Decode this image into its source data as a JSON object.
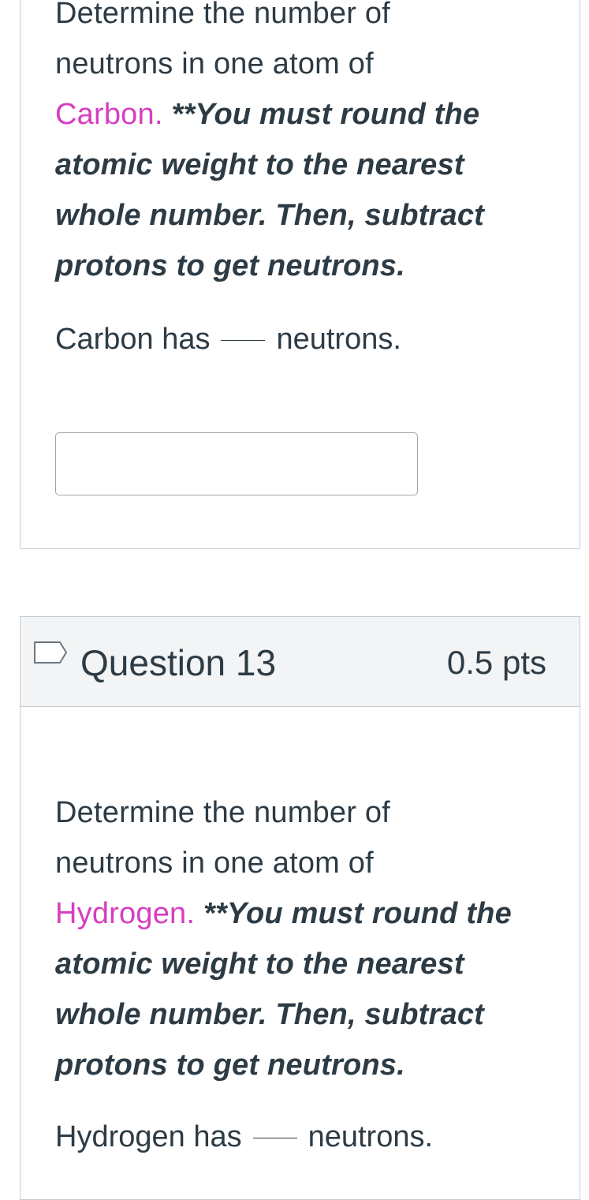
{
  "question_12": {
    "line1": "Determine the number of",
    "line2": "neutrons in one atom of",
    "element": "Carbon.",
    "emph1": " **You must round the",
    "emph2": "atomic weight to the nearest",
    "emph3": "whole number. Then, subtract",
    "emph4": "protons to get neutrons.",
    "fill_before": "Carbon has",
    "fill_after": "neutrons.",
    "answer_value": ""
  },
  "question_13": {
    "title": "Question 13",
    "points": "0.5 pts",
    "line1": "Determine the number of",
    "line2": "neutrons in one atom of",
    "element": "Hydrogen.",
    "emph1": " **You must round the",
    "emph2": "atomic weight to the nearest",
    "emph3": "whole number. Then, subtract",
    "emph4": "protons to get neutrons.",
    "fill_before": "Hydrogen has",
    "fill_after": "neutrons."
  },
  "colors": {
    "element_highlight": "#d63ec1",
    "text": "#2d3b45",
    "border": "#c7cdd1",
    "header_bg": "#f2f4f5"
  },
  "icons": {
    "flag": "flag-question-icon"
  }
}
